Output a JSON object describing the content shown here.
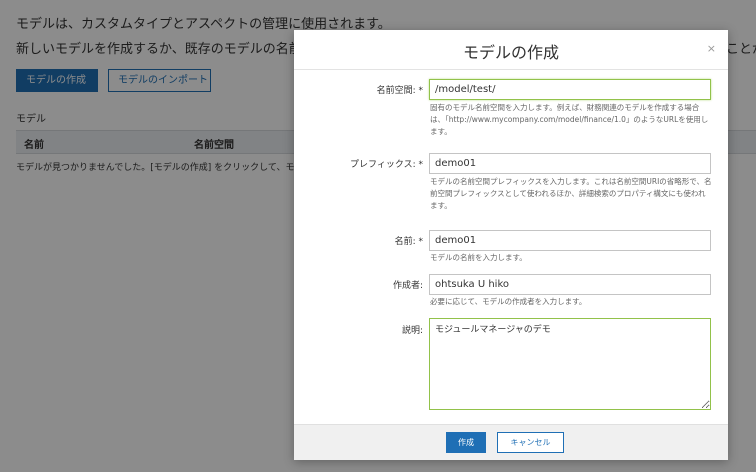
{
  "background": {
    "description_line1": "モデルは、カスタムタイプとアスペクトの管理に使用されます。",
    "description_line2": "新しいモデルを作成するか、既存のモデルの名前",
    "description_line2_tail": "ことが",
    "create_model_button": "モデルの作成",
    "import_model_button": "モデルのインポート",
    "section_label": "モデル",
    "table_headers": {
      "name": "名前",
      "namespace": "名前空間"
    },
    "empty_message": "モデルが見つかりませんでした。[モデルの作成] をクリックして、モ"
  },
  "dialog": {
    "title": "モデルの作成",
    "close_icon": "×",
    "fields": {
      "namespace": {
        "label": "名前空間:",
        "required_mark": "*",
        "value": "/model/test/",
        "help": "固有のモデル名前空間を入力します。例えば、財務関連のモデルを作成する場合は、「http://www.mycompany.com/model/finance/1.0」のようなURLを使用します。"
      },
      "prefix": {
        "label": "プレフィックス:",
        "required_mark": "*",
        "value": "demo01",
        "help": "モデルの名前空間プレフィックスを入力します。これは名前空間URIの省略形で、名前空間プレフィックスとして使われるほか、詳細検索のプロパティ構文にも使われます。"
      },
      "name": {
        "label": "名前:",
        "required_mark": "*",
        "value": "demo01",
        "help": "モデルの名前を入力します。"
      },
      "author": {
        "label": "作成者:",
        "value": "ohtsuka U hiko",
        "help": "必要に応じて、モデルの作成者を入力します。"
      },
      "description": {
        "label": "説明:",
        "value": "モジュールマネージャのデモ"
      }
    },
    "create_button": "作成",
    "cancel_button": "キャンセル"
  },
  "colors": {
    "accent": "#1f6fb5",
    "focus_border": "#92c24a",
    "overlay": "rgba(0,0,0,0.45)"
  }
}
